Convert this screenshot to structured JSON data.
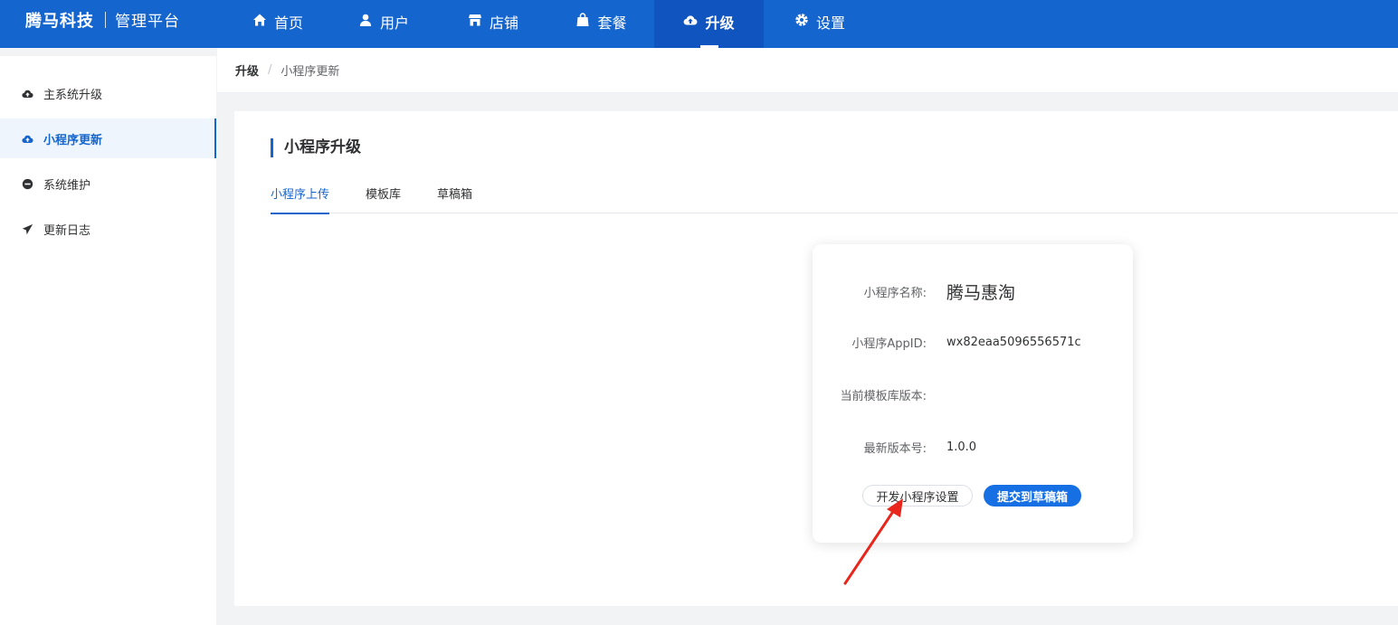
{
  "brand": {
    "name": "腾马科技",
    "subtitle": "管理平台"
  },
  "nav": {
    "items": [
      {
        "label": "首页",
        "icon": "home-icon"
      },
      {
        "label": "用户",
        "icon": "user-icon"
      },
      {
        "label": "店铺",
        "icon": "store-icon"
      },
      {
        "label": "套餐",
        "icon": "bag-icon"
      },
      {
        "label": "升级",
        "icon": "cloud-upload-icon",
        "active": true
      },
      {
        "label": "设置",
        "icon": "gear-icon"
      }
    ]
  },
  "sidebar": {
    "items": [
      {
        "label": "主系统升级",
        "icon": "cloud-upload-icon"
      },
      {
        "label": "小程序更新",
        "icon": "cloud-upload-icon",
        "active": true
      },
      {
        "label": "系统维护",
        "icon": "minus-circle-icon"
      },
      {
        "label": "更新日志",
        "icon": "send-icon"
      }
    ]
  },
  "breadcrumb": {
    "root": "升级",
    "separator": "/",
    "current": "小程序更新"
  },
  "section": {
    "title": "小程序升级"
  },
  "tabs": [
    {
      "label": "小程序上传",
      "active": true
    },
    {
      "label": "模板库"
    },
    {
      "label": "草稿箱"
    }
  ],
  "info": {
    "name_label": "小程序名称:",
    "name_value": "腾马惠淘",
    "appid_label": "小程序AppID:",
    "appid_value": "wx82eaa5096556571c",
    "template_version_label": "当前模板库版本:",
    "template_version_value": "",
    "latest_version_label": "最新版本号:",
    "latest_version_value": "1.0.0"
  },
  "buttons": {
    "settings": "开发小程序设置",
    "submit": "提交到草稿箱"
  },
  "colors": {
    "primary": "#1565cf",
    "nav_active": "#0f54bf",
    "button_primary": "#1670e4",
    "annotation": "#e8261b"
  }
}
